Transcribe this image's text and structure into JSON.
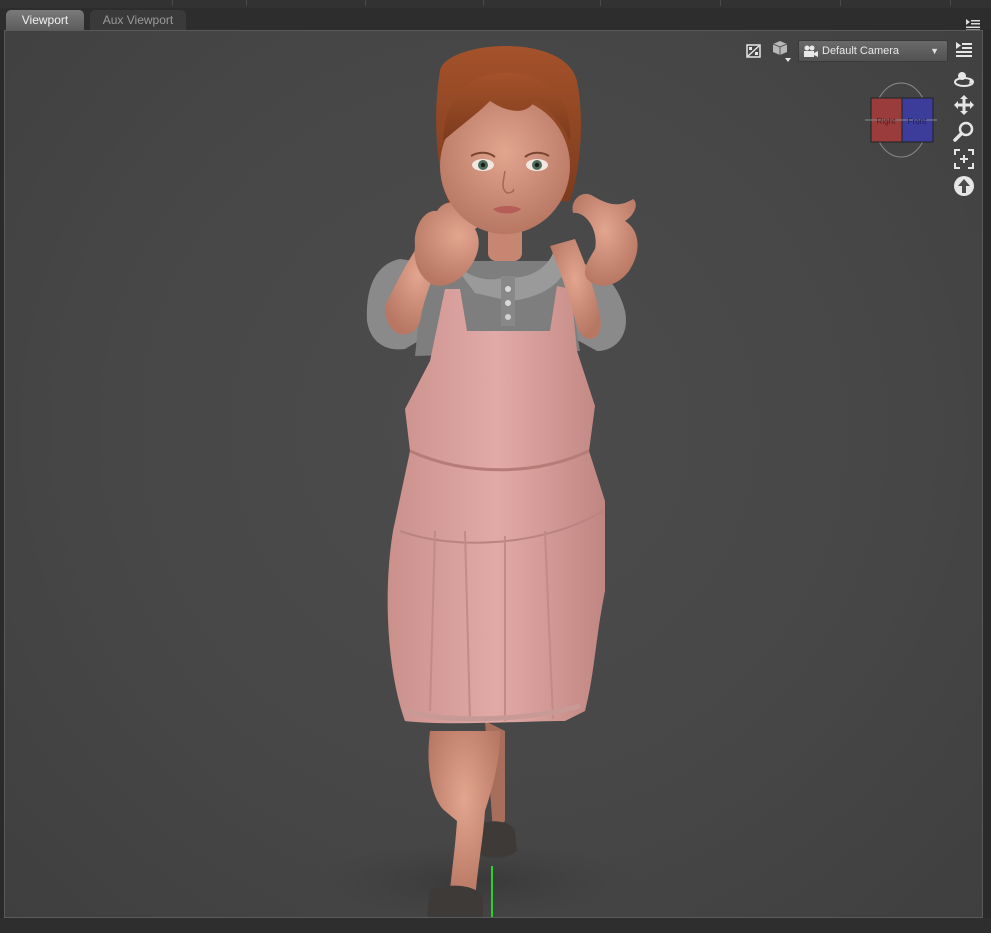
{
  "tabs": [
    {
      "label": "Viewport",
      "active": true
    },
    {
      "label": "Aux Viewport",
      "active": false
    }
  ],
  "camera_select": {
    "selected": "Default Camera",
    "icon": "camera-icon"
  },
  "nav_cube": {
    "left_face": "Right",
    "right_face": "Front"
  },
  "viewport_tools": {
    "left_icons": [
      "draw-style-icon",
      "viewport-view-icon"
    ],
    "right_icons": [
      "pane-options-icon",
      "orbit-icon",
      "pan-icon",
      "zoom-icon",
      "frame-icon",
      "reset-view-icon"
    ]
  },
  "colors": {
    "viewport_bg": "#474747",
    "active_tab": "#6d6d6d",
    "nav_red": "#9b3c3c",
    "nav_blue": "#3c3c9b",
    "y_axis": "#29d029"
  }
}
